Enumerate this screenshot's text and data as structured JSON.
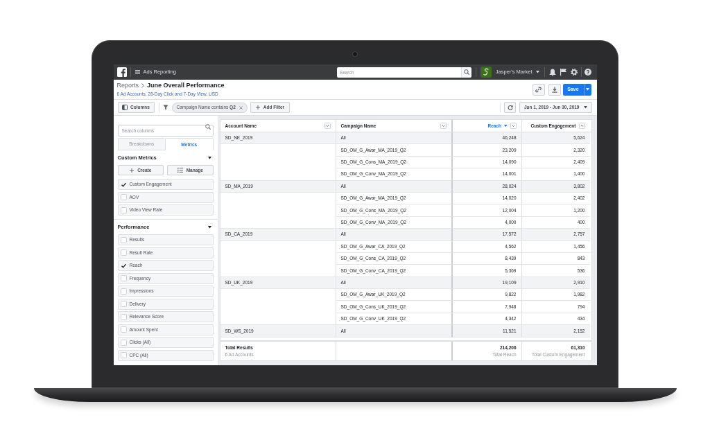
{
  "nav": {
    "app_title": "Ads Reporting",
    "search": {
      "placeholder": "Search"
    },
    "account": {
      "name": "Jasper's Market"
    }
  },
  "header": {
    "breadcrumb": [
      {
        "label": "Reports",
        "current": false
      },
      {
        "label": "June Overall Performance",
        "current": true
      }
    ],
    "subtitle": "6 Ad Accounts, 28-Day Click and 7-Day View, USD",
    "save_button": "Save"
  },
  "filter_bar": {
    "columns_button": "Columns",
    "filters": [
      {
        "text": "Campaign Name contains **Q2**"
      }
    ],
    "add_filter_button": "Add Filter",
    "date_range": "Jun 1, 2019 - Jun 30, 2019"
  },
  "column_picker": {
    "search": {
      "placeholder": "Search columns"
    },
    "tabs": [
      {
        "label": "Breakdowns",
        "selected": false
      },
      {
        "label": "Metrics",
        "selected": true
      }
    ],
    "sections": [
      {
        "title": "Custom Metrics",
        "expanded": true,
        "actions": [
          {
            "kind": "create",
            "label": "Create"
          },
          {
            "kind": "manage",
            "label": "Manage"
          }
        ],
        "items": [
          {
            "label": "Custom Engagement",
            "checked": true
          },
          {
            "label": "AOV",
            "checked": false
          },
          {
            "label": "Video View Rate",
            "checked": false
          }
        ]
      },
      {
        "title": "Performance",
        "expanded": true,
        "items": [
          {
            "label": "Results",
            "checked": false
          },
          {
            "label": "Result Rate",
            "checked": false
          },
          {
            "label": "Reach",
            "checked": true
          },
          {
            "label": "Frequency",
            "checked": false
          },
          {
            "label": "Impressions",
            "checked": false
          },
          {
            "label": "Delivery",
            "checked": false
          },
          {
            "label": "Relevance Score",
            "checked": false
          },
          {
            "label": "Amount Spent",
            "checked": false
          },
          {
            "label": "Clicks (All)",
            "checked": false
          },
          {
            "label": "CPC (All)",
            "checked": false
          }
        ]
      }
    ]
  },
  "table": {
    "columns": [
      {
        "label": "Account Name",
        "kind": "text",
        "sorted": false
      },
      {
        "label": "Campaign Name",
        "kind": "text",
        "sorted": false
      },
      {
        "label": "Reach",
        "kind": "number",
        "sorted": true
      },
      {
        "label": "Custom Engagement",
        "kind": "number",
        "sorted": false
      }
    ],
    "groups": [
      {
        "account": "SD_NE_2019",
        "rows": [
          {
            "campaign": "All",
            "reach": "46,248",
            "custom_engagement": "5,624"
          },
          {
            "campaign": "SD_OM_G_Awar_MA_2019_Q2",
            "reach": "23,209",
            "custom_engagement": "2,320"
          },
          {
            "campaign": "SD_OM_G_Cons_MA_2019_Q2",
            "reach": "14,090",
            "custom_engagement": "2,409"
          },
          {
            "campaign": "SD_OM_G_Conv_MA_2019_Q2",
            "reach": "14,001",
            "custom_engagement": "1,400"
          }
        ]
      },
      {
        "account": "SD_MA_2019",
        "rows": [
          {
            "campaign": "All",
            "reach": "28,024",
            "custom_engagement": "3,802"
          },
          {
            "campaign": "SD_OM_G_Awar_MA_2019_Q2",
            "reach": "14,020",
            "custom_engagement": "2,402"
          },
          {
            "campaign": "SD_OM_G_Cons_MA_2019_Q2",
            "reach": "12,004",
            "custom_engagement": "1,200"
          },
          {
            "campaign": "SD_OM_G_Conv_MA_2019_Q2",
            "reach": "4,000",
            "custom_engagement": "400"
          }
        ]
      },
      {
        "account": "SD_CA_2019",
        "rows": [
          {
            "campaign": "All",
            "reach": "17,572",
            "custom_engagement": "2,757"
          },
          {
            "campaign": "SD_OM_G_Awar_CA_2019_Q2",
            "reach": "4,562",
            "custom_engagement": "1,456"
          },
          {
            "campaign": "SD_OM_G_Cons_CA_2019_Q2",
            "reach": "8,439",
            "custom_engagement": "843"
          },
          {
            "campaign": "SD_OM_G_Conv_CA_2019_Q2",
            "reach": "5,369",
            "custom_engagement": "536"
          }
        ]
      },
      {
        "account": "SD_UK_2019",
        "rows": [
          {
            "campaign": "All",
            "reach": "19,109",
            "custom_engagement": "2,910"
          },
          {
            "campaign": "SD_OM_G_Awar_UK_2019_Q2",
            "reach": "9,822",
            "custom_engagement": "1,982"
          },
          {
            "campaign": "SD_OM_G_Cons_UK_2019_Q2",
            "reach": "7,948",
            "custom_engagement": "794"
          },
          {
            "campaign": "SD_OM_G_Conv_UK_2019_Q2",
            "reach": "4,342",
            "custom_engagement": "434"
          }
        ]
      },
      {
        "account": "SD_WS_2019",
        "rows": [
          {
            "campaign": "All",
            "reach": "11,521",
            "custom_engagement": "2,152"
          }
        ]
      }
    ],
    "totals": {
      "label": "Total Results",
      "sublabel": "6 Ad Accounts",
      "reach": {
        "value": "214,206",
        "label": "Total Reach"
      },
      "custom_engagement": {
        "value": "61,310",
        "label": "Total Custom Engagement"
      }
    }
  }
}
